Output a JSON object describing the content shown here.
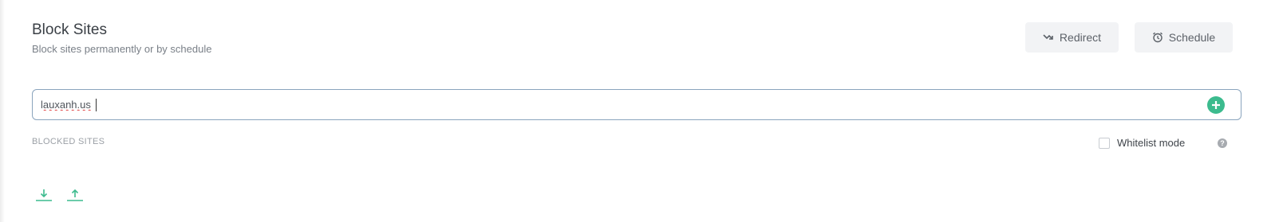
{
  "header": {
    "title": "Block Sites",
    "subtitle": "Block sites permanently or by schedule"
  },
  "toolbar": {
    "redirect_label": "Redirect",
    "redirect_icon": "redirect-arrow-icon",
    "schedule_label": "Schedule",
    "schedule_icon": "alarm-clock-icon"
  },
  "site_input": {
    "value": "lauxanh.us",
    "add_icon": "plus-circle-icon",
    "add_color": "#3cbb8e"
  },
  "blocked_sites": {
    "label": "BLOCKED SITES",
    "whitelist_label": "Whitelist mode",
    "whitelist_checked": false,
    "help_icon": "question-icon",
    "help_glyph": "?",
    "download_icon": "download-icon",
    "upload_icon": "upload-icon",
    "io_color": "#3cbb8e"
  }
}
